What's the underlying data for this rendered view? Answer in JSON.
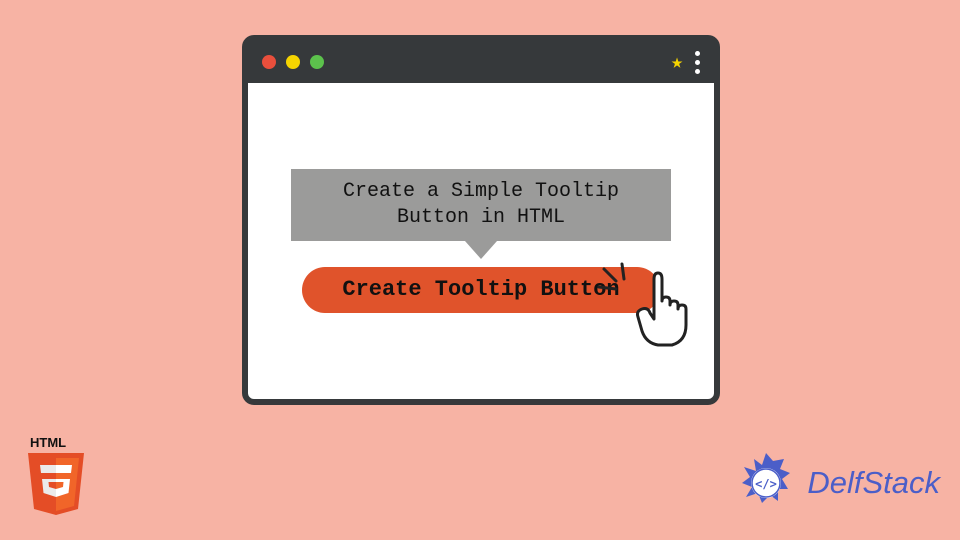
{
  "tooltip": {
    "text": "Create a Simple Tooltip Button in HTML"
  },
  "button": {
    "label": "Create Tooltip Button"
  },
  "badges": {
    "html5_label": "HTML",
    "brand_name": "DelfStack"
  },
  "colors": {
    "background": "#f7b3a4",
    "window_frame": "#36393b",
    "button": "#e0532b",
    "tooltip": "#9b9b9a",
    "star": "#f5d400",
    "brand": "#4b5ec8"
  }
}
